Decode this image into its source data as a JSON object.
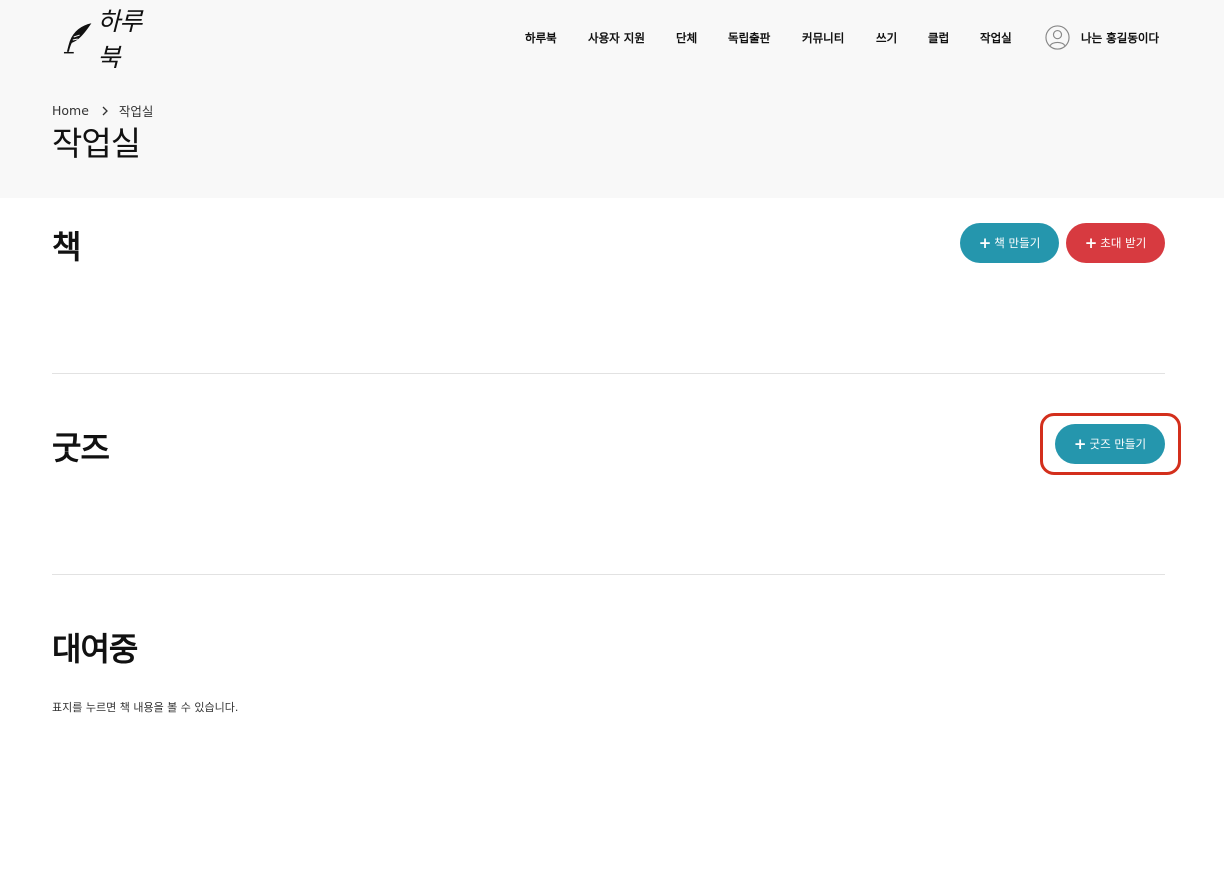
{
  "header": {
    "logo_text": "하루북",
    "nav": [
      {
        "label": "하루북"
      },
      {
        "label": "사용자 지원"
      },
      {
        "label": "단체"
      },
      {
        "label": "독립출판"
      },
      {
        "label": "커뮤니티"
      },
      {
        "label": "쓰기"
      },
      {
        "label": "클럽"
      },
      {
        "label": "작업실"
      }
    ],
    "user_label": "나는 홍길동이다"
  },
  "breadcrumb": {
    "home": "Home",
    "current": "작업실"
  },
  "page_title": "작업실",
  "sections": {
    "books": {
      "title": "책",
      "create_button": "책 만들기",
      "invite_button": "초대 받기"
    },
    "goods": {
      "title": "굿즈",
      "create_button": "굿즈 만들기"
    },
    "rental": {
      "title": "대여중",
      "hint": "표지를 누르면 책 내용을 볼 수 있습니다."
    }
  },
  "colors": {
    "accent_teal": "#2596ad",
    "accent_red": "#d73a40",
    "highlight": "#d32f1c",
    "header_bg": "#f8f8f8"
  }
}
